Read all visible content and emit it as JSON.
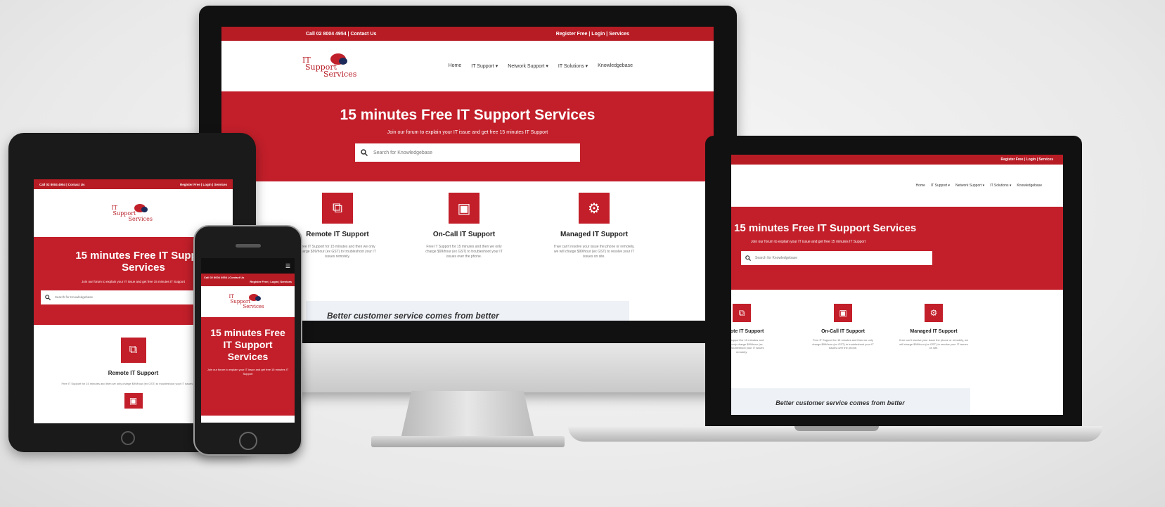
{
  "site": {
    "topbar_left": "Call 02 8004 4954 | Contact Us",
    "topbar_right": "Register Free | Login | Services",
    "phone_topbar_left": "Call 02 8004 4954 | Contact Us",
    "phone_topbar_right": "Register Free | Login | Services",
    "logo_line1": "IT",
    "logo_line2": "Support",
    "logo_line3": "Services",
    "nav": [
      "Home",
      "IT Support ▾",
      "Network Support ▾",
      "IT Solutions ▾",
      "Knowledgebase"
    ],
    "hero_title": "15 minutes Free IT Support Services",
    "hero_sub": "Join our forum to explain your IT issue and get free 15 minutes IT Support",
    "search_placeholder": "Search for Knowledgebase",
    "services": [
      {
        "icon": "remote-desktop-icon",
        "title": "Remote IT Support",
        "text": "Free IT Support for 15 minutes and then we only charge $99/hour (ex GST) to troubleshoot your IT issues remotely."
      },
      {
        "icon": "monitor-user-icon",
        "title": "On-Call IT Support",
        "text": "Free IT Support for 15 minutes and then we only charge $99/hour (ex GST) to troubleshoot your IT issues over the phone."
      },
      {
        "icon": "gears-icon",
        "title": "Managed IT Support",
        "text": "If we can't resolve your issue the phone or remotely, we will charge $99/hour (ex GST) to resolve your IT issues on site."
      }
    ],
    "band_text": "Better customer service comes from better"
  },
  "colors": {
    "brand_red": "#c21f2a",
    "topbar_red": "#b71c25"
  }
}
